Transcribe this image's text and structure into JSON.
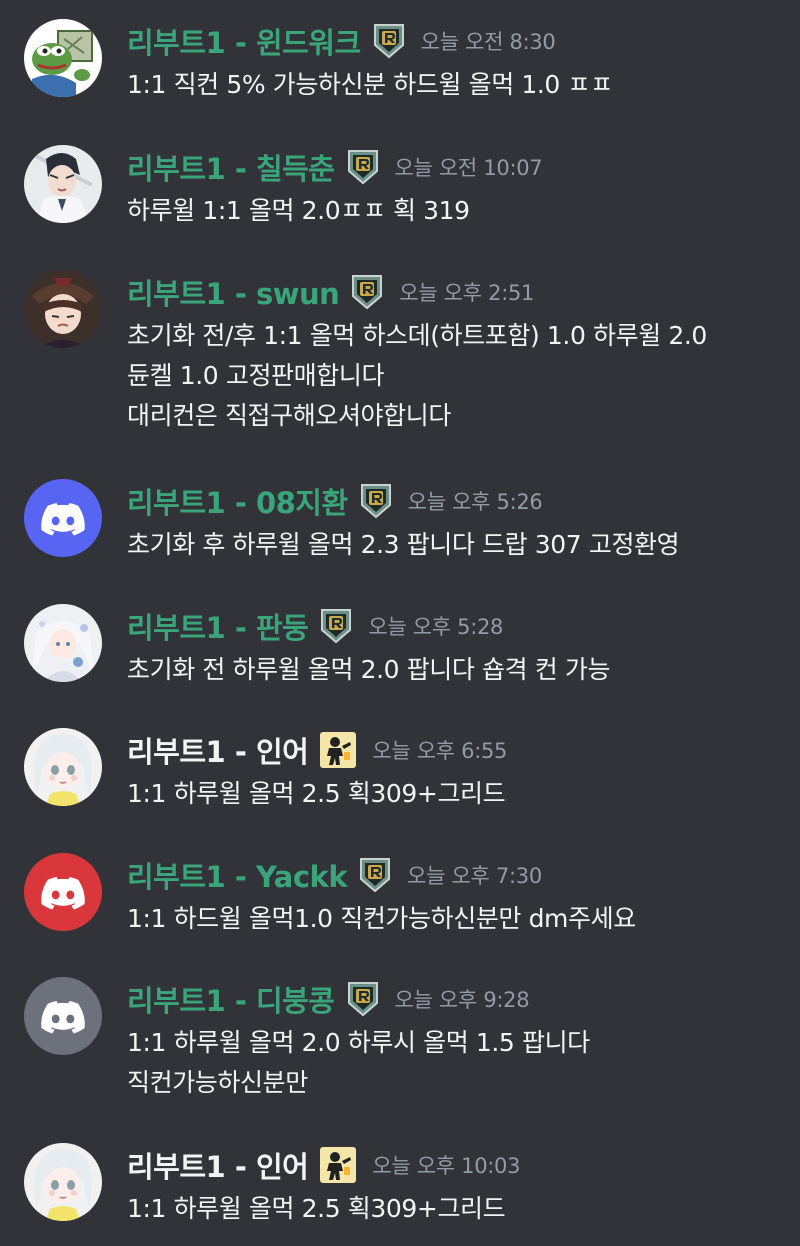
{
  "messages": [
    {
      "username": "리부트1 - 윈드워크",
      "timestamp": "오늘 오전 8:30",
      "badge": "legend-r-badge",
      "name_color": "#3aa57a",
      "lines": [
        "1:1 직컨 5% 가능하신분 하드윌 올먹 1.0 ㅍㅍ"
      ]
    },
    {
      "username": "리부트1 - 칠득춘",
      "timestamp": "오늘 오전 10:07",
      "badge": "legend-r-badge",
      "name_color": "#3aa57a",
      "lines": [
        "하루윌 1:1 올먹 2.0ㅍㅍ 획 319"
      ]
    },
    {
      "username": "리부트1 - swun",
      "timestamp": "오늘 오후 2:51",
      "badge": "legend-r-badge",
      "name_color": "#3aa57a",
      "lines": [
        "초기화 전/후 1:1 올먹 하스데(하트포함) 1.0 하루윌 2.0",
        "듄켈 1.0 고정판매합니다",
        "대리컨은 직접구해오셔야합니다"
      ]
    },
    {
      "username": "리부트1 - 08지환",
      "timestamp": "오늘 오후 5:26",
      "badge": "legend-r-badge",
      "name_color": "#3aa57a",
      "lines": [
        "초기화 후 하루윌 올먹 2.3 팝니다 드랍 307 고정환영"
      ]
    },
    {
      "username": "리부트1 - 판둥",
      "timestamp": "오늘 오후 5:28",
      "badge": "legend-r-badge",
      "name_color": "#3aa57a",
      "lines": [
        "초기화 전 하루윌 올먹 2.0 팝니다 숍격 컨 가능"
      ]
    },
    {
      "username": "리부트1 -  인어",
      "timestamp": "오늘 오후 6:55",
      "badge": "pixel-figure-badge",
      "name_color": "#f2f3f5",
      "lines": [
        "1:1 하루윌 올먹 2.5 획309+그리드"
      ]
    },
    {
      "username": "리부트1 - Yackk",
      "timestamp": "오늘 오후 7:30",
      "badge": "legend-r-badge",
      "name_color": "#3aa57a",
      "lines": [
        "1:1 하드윌 올먹1.0 직컨가능하신분만 dm주세요"
      ]
    },
    {
      "username": "리부트1 - 디붕콩",
      "timestamp": "오늘 오후 9:28",
      "badge": "legend-r-badge",
      "name_color": "#3aa57a",
      "lines": [
        "1:1 하루윌 올먹 2.0 하루시 올먹 1.5 팝니다",
        "직컨가능하신분만"
      ]
    },
    {
      "username": "리부트1 -  인어",
      "timestamp": "오늘 오후 10:03",
      "badge": "pixel-figure-badge",
      "name_color": "#f2f3f5",
      "lines": [
        "1:1 하루윌 올먹 2.5 획309+그리드"
      ]
    }
  ],
  "colors": {
    "background": "#313338",
    "green_name": "#3aa57a",
    "timestamp": "#949ba4",
    "discord_blurple": "#5865f2",
    "discord_red": "#da373c",
    "discord_grey": "#6d717b"
  },
  "avatars": [
    "frog-avatar",
    "anime-man-avatar",
    "anime-girl-avatar",
    "discord-logo-avatar-blurple",
    "anime-white-hair-avatar",
    "anime-mermaid-avatar",
    "discord-logo-avatar-red",
    "discord-logo-avatar-grey",
    "anime-mermaid-avatar"
  ]
}
